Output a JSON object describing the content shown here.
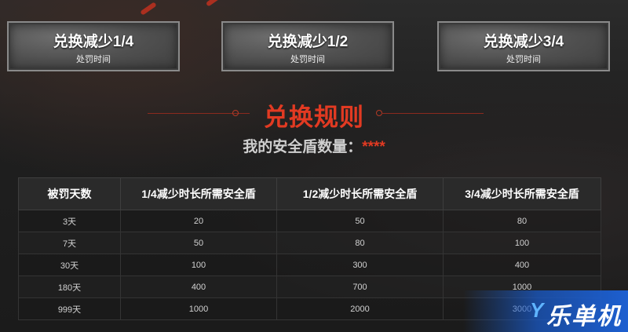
{
  "buttons": [
    {
      "label": "兑换减少1/4",
      "sub": "处罚时间"
    },
    {
      "label": "兑换减少1/2",
      "sub": "处罚时间"
    },
    {
      "label": "兑换减少3/4",
      "sub": "处罚时间"
    }
  ],
  "rules": {
    "title": "兑换规则",
    "shield_label": "我的安全盾数量：",
    "shield_value": "****"
  },
  "table": {
    "headers": [
      "被罚天数",
      "1/4减少时长所需安全盾",
      "1/2减少时长所需安全盾",
      "3/4减少时长所需安全盾"
    ],
    "rows": [
      [
        "3天",
        "20",
        "50",
        "80"
      ],
      [
        "7天",
        "50",
        "80",
        "100"
      ],
      [
        "30天",
        "100",
        "300",
        "400"
      ],
      [
        "180天",
        "400",
        "700",
        "1000"
      ],
      [
        "999天",
        "1000",
        "2000",
        "3000"
      ]
    ]
  },
  "watermark": {
    "text": "乐单机"
  },
  "colors": {
    "accent": "#e23a22",
    "button_bg": "#555555"
  }
}
